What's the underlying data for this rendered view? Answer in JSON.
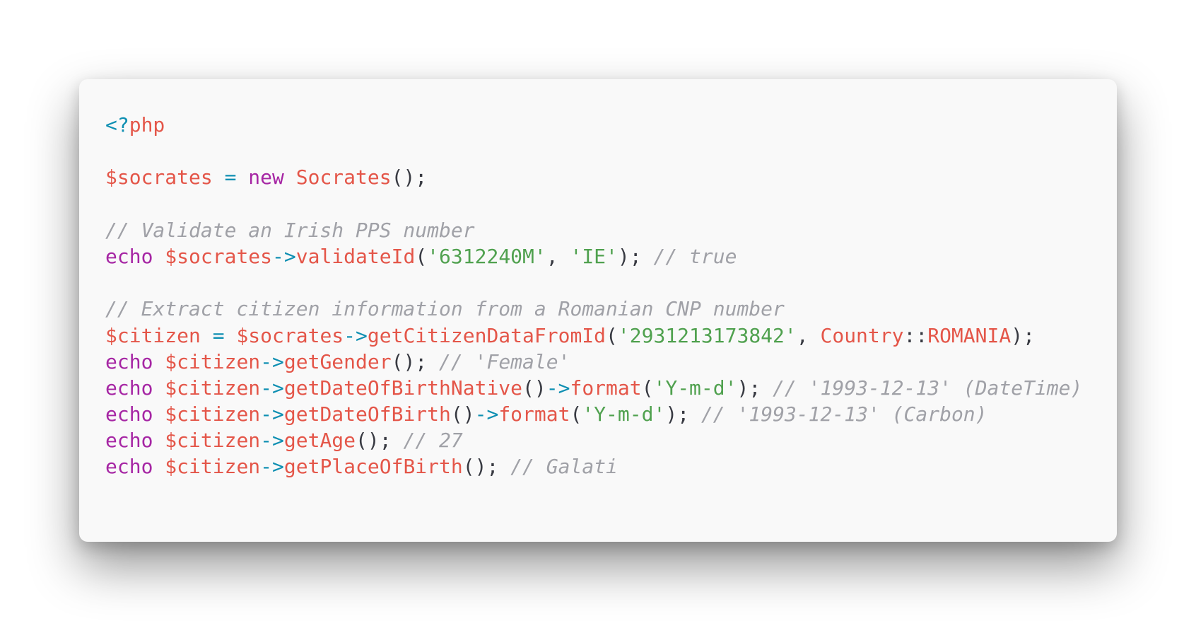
{
  "code_window": {
    "language": "php",
    "lines": [
      [
        {
          "t": "<?",
          "c": "meta"
        },
        {
          "t": "php",
          "c": "tag"
        }
      ],
      [],
      [
        {
          "t": "$socrates",
          "c": "var"
        },
        {
          "t": " ",
          "c": "punct"
        },
        {
          "t": "=",
          "c": "op"
        },
        {
          "t": " ",
          "c": "punct"
        },
        {
          "t": "new",
          "c": "keyword"
        },
        {
          "t": " ",
          "c": "punct"
        },
        {
          "t": "Socrates",
          "c": "class"
        },
        {
          "t": "();",
          "c": "punct"
        }
      ],
      [],
      [
        {
          "t": "// Validate an Irish PPS number",
          "c": "comment"
        }
      ],
      [
        {
          "t": "echo",
          "c": "keyword"
        },
        {
          "t": " ",
          "c": "punct"
        },
        {
          "t": "$socrates",
          "c": "var"
        },
        {
          "t": "->",
          "c": "op"
        },
        {
          "t": "validateId",
          "c": "method"
        },
        {
          "t": "(",
          "c": "punct"
        },
        {
          "t": "'6312240M'",
          "c": "string"
        },
        {
          "t": ", ",
          "c": "punct"
        },
        {
          "t": "'IE'",
          "c": "string"
        },
        {
          "t": "); ",
          "c": "punct"
        },
        {
          "t": "// true",
          "c": "comment"
        }
      ],
      [],
      [
        {
          "t": "// Extract citizen information from a Romanian CNP number",
          "c": "comment"
        }
      ],
      [
        {
          "t": "$citizen",
          "c": "var"
        },
        {
          "t": " ",
          "c": "punct"
        },
        {
          "t": "=",
          "c": "op"
        },
        {
          "t": " ",
          "c": "punct"
        },
        {
          "t": "$socrates",
          "c": "var"
        },
        {
          "t": "->",
          "c": "op"
        },
        {
          "t": "getCitizenDataFromId",
          "c": "method"
        },
        {
          "t": "(",
          "c": "punct"
        },
        {
          "t": "'2931213173842'",
          "c": "string"
        },
        {
          "t": ", ",
          "c": "punct"
        },
        {
          "t": "Country",
          "c": "class"
        },
        {
          "t": "::",
          "c": "punct"
        },
        {
          "t": "ROMANIA",
          "c": "class"
        },
        {
          "t": ");",
          "c": "punct"
        }
      ],
      [
        {
          "t": "echo",
          "c": "keyword"
        },
        {
          "t": " ",
          "c": "punct"
        },
        {
          "t": "$citizen",
          "c": "var"
        },
        {
          "t": "->",
          "c": "op"
        },
        {
          "t": "getGender",
          "c": "method"
        },
        {
          "t": "(); ",
          "c": "punct"
        },
        {
          "t": "// 'Female'",
          "c": "comment"
        }
      ],
      [
        {
          "t": "echo",
          "c": "keyword"
        },
        {
          "t": " ",
          "c": "punct"
        },
        {
          "t": "$citizen",
          "c": "var"
        },
        {
          "t": "->",
          "c": "op"
        },
        {
          "t": "getDateOfBirthNative",
          "c": "method"
        },
        {
          "t": "()",
          "c": "punct"
        },
        {
          "t": "->",
          "c": "op"
        },
        {
          "t": "format",
          "c": "method"
        },
        {
          "t": "(",
          "c": "punct"
        },
        {
          "t": "'Y-m-d'",
          "c": "string"
        },
        {
          "t": "); ",
          "c": "punct"
        },
        {
          "t": "// '1993-12-13' (DateTime)",
          "c": "comment"
        }
      ],
      [
        {
          "t": "echo",
          "c": "keyword"
        },
        {
          "t": " ",
          "c": "punct"
        },
        {
          "t": "$citizen",
          "c": "var"
        },
        {
          "t": "->",
          "c": "op"
        },
        {
          "t": "getDateOfBirth",
          "c": "method"
        },
        {
          "t": "()",
          "c": "punct"
        },
        {
          "t": "->",
          "c": "op"
        },
        {
          "t": "format",
          "c": "method"
        },
        {
          "t": "(",
          "c": "punct"
        },
        {
          "t": "'Y-m-d'",
          "c": "string"
        },
        {
          "t": "); ",
          "c": "punct"
        },
        {
          "t": "// '1993-12-13' (Carbon)",
          "c": "comment"
        }
      ],
      [
        {
          "t": "echo",
          "c": "keyword"
        },
        {
          "t": " ",
          "c": "punct"
        },
        {
          "t": "$citizen",
          "c": "var"
        },
        {
          "t": "->",
          "c": "op"
        },
        {
          "t": "getAge",
          "c": "method"
        },
        {
          "t": "(); ",
          "c": "punct"
        },
        {
          "t": "// 27",
          "c": "comment"
        }
      ],
      [
        {
          "t": "echo",
          "c": "keyword"
        },
        {
          "t": " ",
          "c": "punct"
        },
        {
          "t": "$citizen",
          "c": "var"
        },
        {
          "t": "->",
          "c": "op"
        },
        {
          "t": "getPlaceOfBirth",
          "c": "method"
        },
        {
          "t": "(); ",
          "c": "punct"
        },
        {
          "t": "// Galati",
          "c": "comment"
        }
      ]
    ]
  },
  "colors": {
    "window_background": "#f9f9f9",
    "page_background": "#ffffff",
    "punctuation": "#383a42",
    "meta": "#0e8fb2",
    "variable": "#e45649",
    "keyword": "#a626a4",
    "operator": "#0e8fb2",
    "method": "#e45649",
    "string": "#50a14f",
    "comment": "#a0a1a7"
  }
}
